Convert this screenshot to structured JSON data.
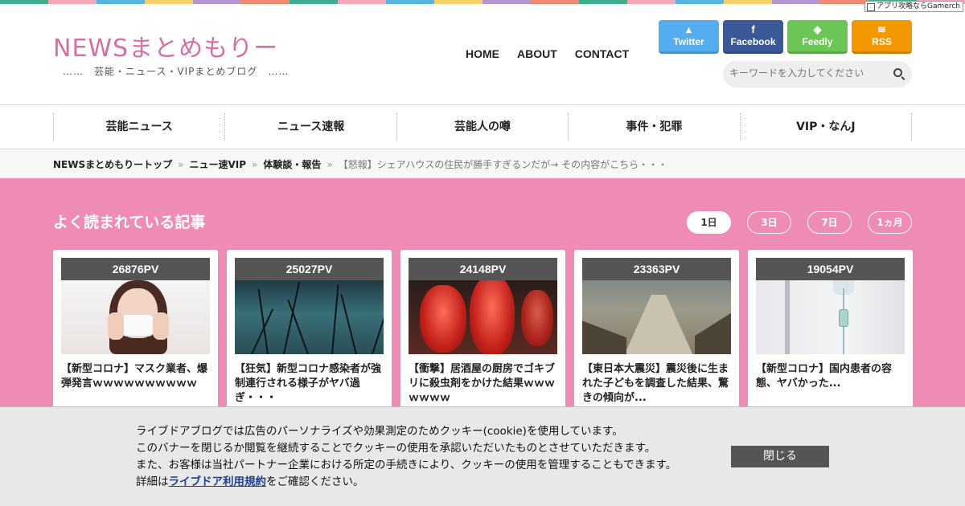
{
  "topbar_colors": [
    "#3fae8c",
    "#f4a7b9",
    "#57b6e0",
    "#f5d26b",
    "#b395cf",
    "#f08a72",
    "#3fae8c",
    "#f4a7b9",
    "#57b6e0",
    "#f5d26b",
    "#b395cf",
    "#f08a72",
    "#3fae8c",
    "#f4a7b9",
    "#57b6e0",
    "#f5d26b",
    "#b395cf",
    "#f08a72",
    "#3fae8c",
    "#f4a7b9"
  ],
  "gamerch": "アプリ攻略ならGamerch",
  "site": {
    "logo": "NEWSまとめもりー",
    "tagline": "……　芸能・ニュース・VIPまとめブログ　……"
  },
  "nav": [
    "HOME",
    "ABOUT",
    "CONTACT"
  ],
  "social": [
    {
      "label": "Twitter",
      "icon": "twitter-bird-icon",
      "glyph": "🐦",
      "color": "#55acee"
    },
    {
      "label": "Facebook",
      "icon": "facebook-f-icon",
      "glyph": "f",
      "color": "#3b5998"
    },
    {
      "label": "Feedly",
      "icon": "feedly-icon",
      "glyph": "◈",
      "color": "#6cc655"
    },
    {
      "label": "RSS",
      "icon": "rss-icon",
      "glyph": "◠",
      "color": "#f39800"
    }
  ],
  "search": {
    "placeholder": "キーワードを入力してください",
    "icon": "search-icon"
  },
  "categories": [
    "芸能ニュース",
    "ニュース速報",
    "芸能人の噂",
    "事件・犯罪",
    "VIP・なんJ"
  ],
  "breadcrumb": {
    "items": [
      "NEWSまとめもりートップ",
      "ニュー速VIP",
      "体験談・報告"
    ],
    "current": "【怒報】シェアハウスの住民が勝手すぎるンだが→ その内容がこちら・・・",
    "separator": "»"
  },
  "popular": {
    "title": "よく読まれている記事",
    "periods": [
      "1日",
      "3日",
      "7日",
      "1ヵ月"
    ],
    "active_period": 0,
    "cards": [
      {
        "pv": "26876PV",
        "title": "【新型コロナ】マスク業者、爆弾発言ｗｗｗｗｗｗｗｗｗｗ"
      },
      {
        "pv": "25027PV",
        "title": "【狂気】新型コロナ感染者が強制連行される様子がヤバ過ぎ・・・"
      },
      {
        "pv": "24148PV",
        "title": "【衝撃】居酒屋の厨房でゴキブリに殺虫剤をかけた結果ｗｗｗｗｗｗｗ"
      },
      {
        "pv": "23363PV",
        "title": "【東日本大震災】震災後に生まれた子どもを調査した結果、驚きの傾向が..."
      },
      {
        "pv": "19054PV",
        "title": "【新型コロナ】国内患者の容態、ヤバかった..."
      }
    ]
  },
  "cookie": {
    "line1": "ライブドアブログでは広告のパーソナライズや効果測定のためクッキー(cookie)を使用しています。",
    "line2": "このバナーを閉じるか閲覧を継続することでクッキーの使用を承認いただいたものとさせていただきます。",
    "line3": "また、お客様は当社パートナー企業における所定の手続きにより、クッキーの使用を管理することもできます。",
    "line4_prefix": "詳細は",
    "link": "ライブドア利用規約",
    "line4_suffix": "をご確認ください。",
    "close": "閉じる"
  }
}
